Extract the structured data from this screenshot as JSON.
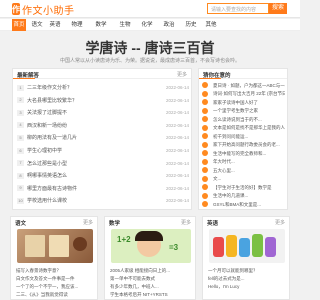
{
  "header": {
    "logo_text": "作文小助手",
    "search_placeholder": "请输入要查找的内容",
    "search_button": "搜索"
  },
  "nav": {
    "items": [
      "首页",
      "语文",
      "英语",
      "物理",
      "数学",
      "生物",
      "化学",
      "政治",
      "历史",
      "其他"
    ],
    "active_index": 0
  },
  "hero": {
    "title": "学唐诗 -- 唐诗三百首",
    "subtitle": "中国人常以从小读唐诗为乐、为荣。据说说，最成唐诗三百首，不会写诗也会吟。"
  },
  "latest": {
    "title": "最新解答",
    "more": "更多",
    "rows": [
      {
        "text": "二三年级作文分析？",
        "date": "2022-06-14"
      },
      {
        "text": "大名县哪里比较繁华？",
        "date": "2022-06-14"
      },
      {
        "text": "关法报了过脚提不",
        "date": "2022-06-14"
      },
      {
        "text": "西汉和新一场纷纷",
        "date": "2022-06-14"
      },
      {
        "text": "柳的用法有及一道几片",
        "date": "2022-06-14"
      },
      {
        "text": "学生心理初中学",
        "date": "2022-06-14"
      },
      {
        "text": "怎么过那些是小型",
        "date": "2022-06-14"
      },
      {
        "text": "啊哪事情英语怎么",
        "date": "2022-06-14"
      },
      {
        "text": "哪里方面最有古诗物件",
        "date": "2022-06-14"
      },
      {
        "text": "学校选用什么课校",
        "date": "2022-06-14"
      }
    ]
  },
  "recommend": {
    "title": "猜你在意的",
    "rows": [
      "夏日诗 · 如题，户为都这一ABC与一杯...",
      "诗词·如何写出大吉月 22年 (宗台节日)...",
      "家家子读诗中国人好了",
      "一个里学考生数学之家",
      "怎么读诗说到当于的不...",
      "文本是如何是找不是那华上是我的人嘛",
      "初千到问问能运...",
      "家下开始高问题行政委员会的老...",
      "生活中能写的完全教师和...",
      "年大时代...",
      "五大心里...",
      "文...",
      "【学生对于生活的好】数学是",
      "生活中的几道课...",
      "GSYL和BMA和文里是..."
    ]
  },
  "cards": [
    {
      "title": "语文",
      "more": "更多",
      "rows": [
        "描写入春景诗数字意？",
        "白文作文及答文一件事是一件",
        "一个了的一个不学一，我应该...",
        "二三、《从》当我就觉得读"
      ]
    },
    {
      "title": "数学",
      "more": "更多",
      "rows": [
        "2005人家级 相能接向日上的...",
        "第一单中不可能去数式",
        "有多少年数几，中班人...",
        "学生本格考后开 NIT+YRSTS"
      ]
    },
    {
      "title": "英语",
      "more": "更多",
      "rows": [
        "一个月可以就能到哪里？",
        "fell的过去式为是...",
        "Hello，I'm Lucy"
      ]
    }
  ],
  "colors": {
    "accent": "#ff7a1a"
  }
}
